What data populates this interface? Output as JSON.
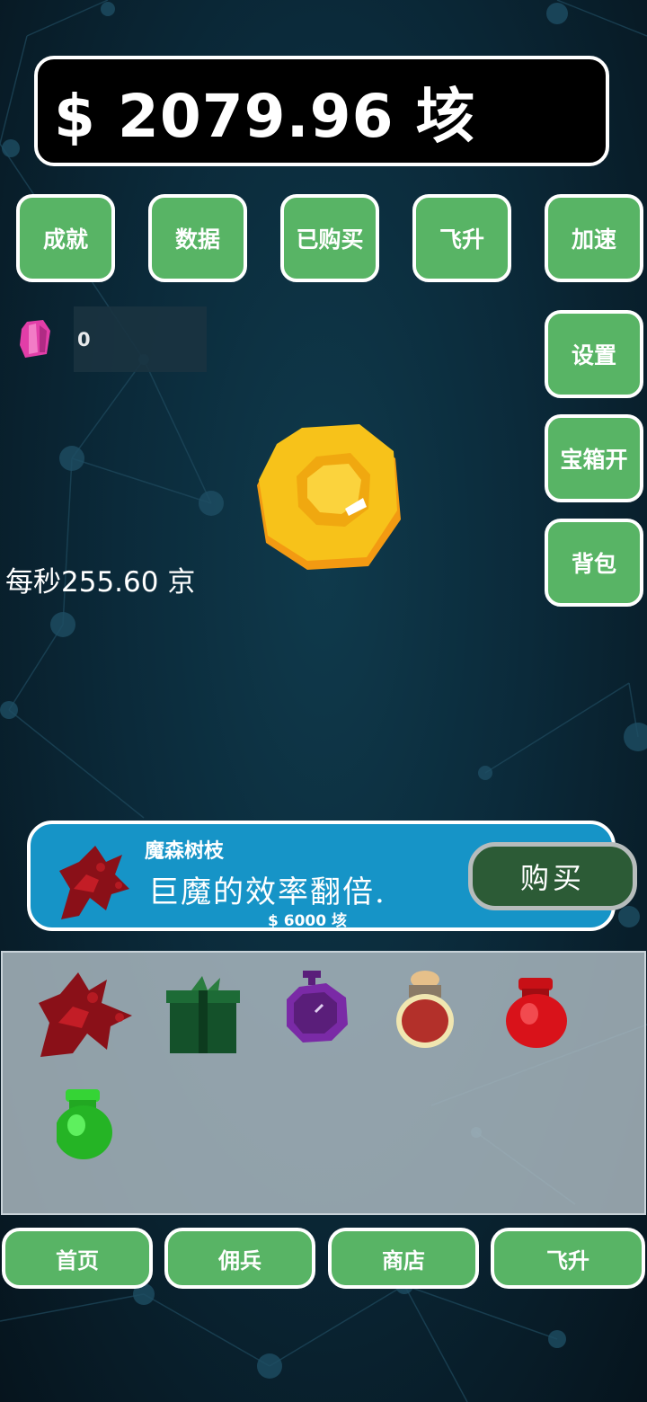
{
  "money": {
    "text": "$ 2079.96 垓"
  },
  "top_buttons": [
    "成就",
    "数据",
    "已购买",
    "飞升",
    "加速"
  ],
  "side_buttons": [
    "设置",
    "宝箱开",
    "背包"
  ],
  "gems": {
    "count": "0",
    "icon": "pink-gem-icon"
  },
  "coin": {
    "icon": "gold-coin-icon"
  },
  "rate": {
    "text": "每秒255.60 京"
  },
  "offer": {
    "title": "魔森树枝",
    "description": "巨魔的效率翻倍.",
    "price": "$ 6000 垓",
    "buy_label": "购买",
    "icon": "demon-branch-icon"
  },
  "inventory": [
    "demon-branch-icon",
    "green-gift-icon",
    "purple-stopwatch-icon",
    "red-potion-jar-icon",
    "red-jar-icon",
    "green-jar-icon"
  ],
  "bottom_nav": [
    "首页",
    "佣兵",
    "商店",
    "飞升"
  ],
  "colors": {
    "button_green": "#58b465",
    "offer_blue": "#1694c7",
    "buy_dark_green": "#2c5b36",
    "coin_gold": "#f7c21a"
  }
}
